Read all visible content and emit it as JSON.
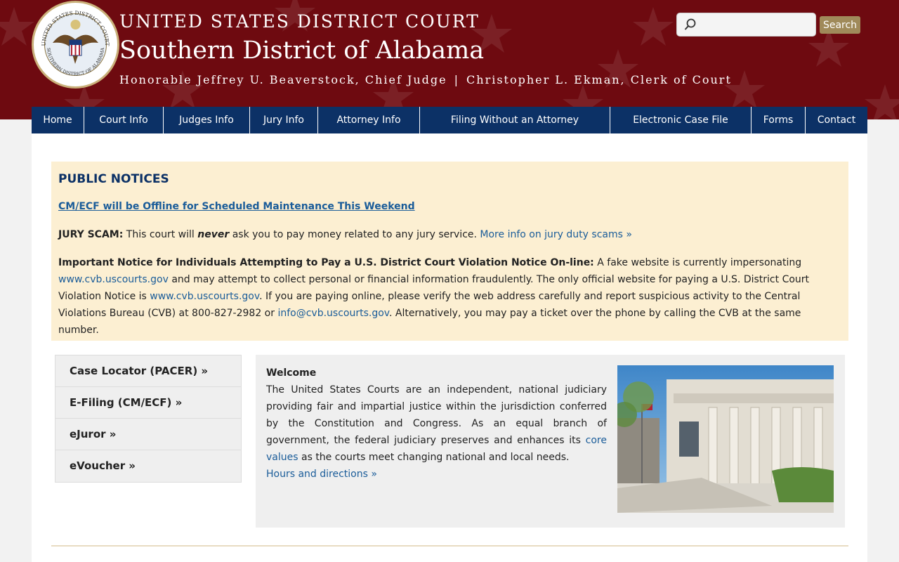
{
  "header": {
    "court_line1": "UNITED STATES DISTRICT COURT",
    "court_line2": "Southern District of Alabama",
    "chief_judge": "Honorable Jeffrey U. Beaverstock, Chief Judge",
    "separator": "|",
    "clerk": "Christopher L. Ekman, Clerk of Court",
    "seal_text_top": "UNITED STATES DISTRICT COURT",
    "seal_text_bottom": "SOUTHERN DISTRICT OF ALABAMA"
  },
  "search": {
    "placeholder": "",
    "button_label": "Search"
  },
  "nav": {
    "items": [
      {
        "label": "Home"
      },
      {
        "label": "Court Info"
      },
      {
        "label": "Judges Info"
      },
      {
        "label": "Jury Info"
      },
      {
        "label": "Attorney Info"
      },
      {
        "label": "Filing Without an Attorney"
      },
      {
        "label": "Electronic Case File"
      },
      {
        "label": "Forms"
      },
      {
        "label": "Contact"
      }
    ]
  },
  "notices": {
    "heading": "PUBLIC NOTICES",
    "maintenance_link": "CM/ECF will be Offline for Scheduled Maintenance This Weekend",
    "jury_scam_label": "JURY SCAM:",
    "jury_scam_text_a": " This court will ",
    "jury_scam_emph": "never",
    "jury_scam_text_b": " ask you to pay money related to any jury service. ",
    "jury_scam_link": "More info on jury duty scams »",
    "violation_label": "Important Notice for Individuals Attempting to Pay a U.S. District Court Violation Notice On-line:",
    "violation_text_a": " A fake website is currently impersonating ",
    "fake_site_link": "www.cvb.uscourts.gov",
    "violation_text_b": " and may attempt to collect personal or financial information fraudulently. The only official website for paying a U.S. District Court Violation Notice is ",
    "official_site_link": "www.cvb.uscourts.gov",
    "violation_text_c": ". If you are paying online, please verify the web address carefully and report suspicious activity to the Central Violations Bureau (CVB) at 800-827-2982 or ",
    "email_link": "info@cvb.uscourts.gov",
    "violation_text_d": ". Alternatively, you may pay a ticket over the phone by calling the CVB at the same number."
  },
  "quicklinks": [
    {
      "label": "Case Locator (PACER) »"
    },
    {
      "label": "E-Filing (CM/ECF) »"
    },
    {
      "label": "eJuror »"
    },
    {
      "label": "eVoucher »"
    }
  ],
  "welcome": {
    "heading": "Welcome",
    "text_a": "The United States Courts are an independent, national judiciary providing fair and impartial justice within the jurisdiction conferred by the Constitution and Congress. As an equal branch of government, the federal judiciary preserves and enhances its ",
    "core_values_link": "core values",
    "text_b": " as the courts meet changing national and local needs.",
    "hours_link": "Hours and directions »"
  },
  "colors": {
    "banner": "#6e0a10",
    "nav": "#0c3166",
    "notice_bg": "#fcefd2",
    "link": "#1a5c99",
    "search_button": "#a08a5a"
  },
  "icons": {
    "search": "magnifier-icon",
    "seal": "court-seal-icon"
  }
}
